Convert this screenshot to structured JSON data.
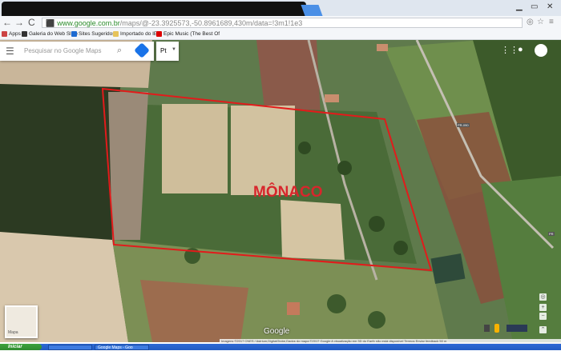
{
  "browser": {
    "url_host": "www.google.com.br",
    "url_rest": "/maps/@-23.3925573,-50.8961689,430m/data=!3m1!1e3",
    "nav_back": "←",
    "nav_forward": "→",
    "nav_reload": "C",
    "nav_lock": "🔒"
  },
  "bookmarks": [
    {
      "label": "Apps",
      "color": "#c44"
    },
    {
      "label": "Galeria do Web Slice",
      "color": "#333"
    },
    {
      "label": "Sites Sugeridos",
      "color": "#1e6bd1"
    },
    {
      "label": "Importado do IE",
      "color": "#e6c35a"
    },
    {
      "label": "Epic Music (The Best Of",
      "color": "#d00"
    }
  ],
  "maps": {
    "search_placeholder": "Pesquisar no Google Maps",
    "language": "Pt",
    "logo": "Google",
    "minimap_label": "Mapa",
    "overlay_text": "MÔNACO",
    "road_label_1": "PR-090",
    "road_label_2": "PR",
    "footer": "Imagens ©2017 CNES / Astrium,DigitalGlobe,Dados do mapa ©2017 Google   A visualização em 3D do Earth não está disponível   Termos   Enviar feedback   50 m"
  },
  "taskbar": {
    "start": "Iniciar",
    "tasks": [
      "",
      "Google Maps - Goo"
    ]
  },
  "colors": {
    "polygon": "#e21b1b",
    "accent": "#1a73e8"
  }
}
